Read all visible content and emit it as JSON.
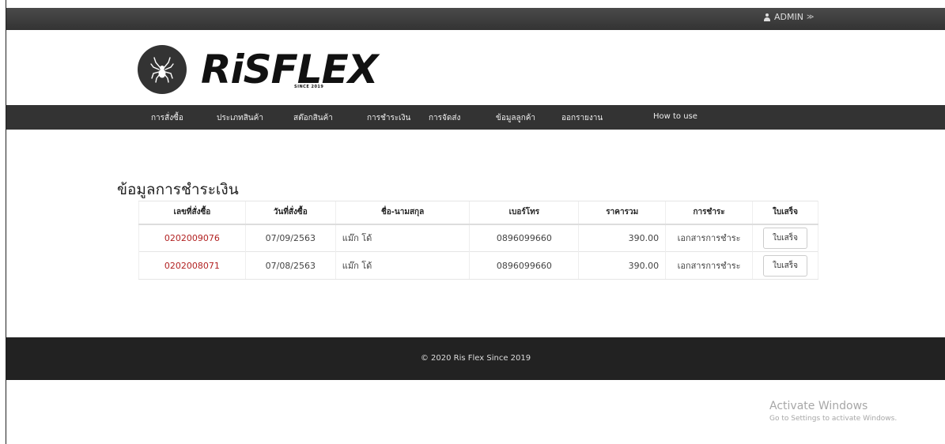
{
  "header": {
    "admin_label": "ADMIN",
    "admin_chevron": "≫"
  },
  "logo": {
    "brand": "RiSFLEX",
    "since": "SINCE 2019",
    "icon": "spider-icon"
  },
  "nav": {
    "items": [
      {
        "label": "การสั่งซื้อ"
      },
      {
        "label": "ประเภทสินค้า"
      },
      {
        "label": "สต๊อกสินค้า"
      },
      {
        "label": "การชำระเงิน"
      },
      {
        "label": "การจัดส่ง"
      },
      {
        "label": "ข้อมูลลูกค้า"
      },
      {
        "label": "ออกรายงาน"
      },
      {
        "label": "How to use"
      }
    ]
  },
  "main": {
    "title": "ข้อมูลการชำระเงิน",
    "columns": [
      "เลขที่สั่งซื้อ",
      "วันที่สั่งซื้อ",
      "ชื่อ-นามสกุล",
      "เบอร์โทร",
      "ราคารวม",
      "การชำระ",
      "ใบเสร็จ"
    ],
    "rows": [
      {
        "order_no": "0202009076",
        "date": "07/09/2563",
        "name": "แม๊ก โด้",
        "phone": "0896099660",
        "total": "390.00",
        "payment": "เอกสารการชำระ",
        "receipt": "ใบเสร็จ"
      },
      {
        "order_no": "0202008071",
        "date": "07/08/2563",
        "name": "แม๊ก โด้",
        "phone": "0896099660",
        "total": "390.00",
        "payment": "เอกสารการชำระ",
        "receipt": "ใบเสร็จ"
      }
    ]
  },
  "footer": {
    "text": "© 2020 Ris Flex Since 2019"
  },
  "watermark": {
    "title": "Activate Windows",
    "subtitle": "Go to Settings to activate Windows."
  },
  "colors": {
    "topbar": "#3a3a3a",
    "navbar": "#333333",
    "footer": "#222222",
    "order_link": "#b22222"
  }
}
